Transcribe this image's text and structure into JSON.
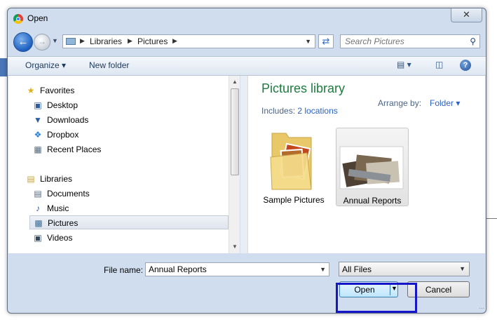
{
  "window": {
    "title": "Open",
    "close_glyph": "✕"
  },
  "address": {
    "segments": [
      "Libraries",
      "Pictures"
    ]
  },
  "search": {
    "placeholder": "Search Pictures"
  },
  "toolbar": {
    "organize": "Organize",
    "new_folder": "New folder"
  },
  "nav_pane": {
    "favorites_header": "Favorites",
    "favorites": [
      "Desktop",
      "Downloads",
      "Dropbox",
      "Recent Places"
    ],
    "libraries_header": "Libraries",
    "libraries": [
      "Documents",
      "Music",
      "Pictures",
      "Videos"
    ],
    "selected": "Pictures"
  },
  "content": {
    "title": "Pictures library",
    "includes_label": "Includes:",
    "includes_link": "2 locations",
    "arrange_label": "Arrange by:",
    "arrange_value": "Folder",
    "items": [
      "Sample Pictures",
      "Annual Reports"
    ],
    "selected_item": "Annual Reports"
  },
  "bottom": {
    "file_name_label": "File name:",
    "file_name_value": "Annual Reports",
    "filter_value": "All Files",
    "open_label": "Open",
    "cancel_label": "Cancel"
  },
  "colors": {
    "library_title": "#1e7a3f",
    "link": "#2b62c6",
    "highlight_box": "#1616c8",
    "back_button": "#1c5fc0"
  },
  "icons": {
    "back": "arrow-left-icon",
    "forward": "arrow-right-icon",
    "refresh": "refresh-icon",
    "search": "search-icon",
    "help": "help-icon",
    "favorites": "star-icon",
    "libraries": "library-icon"
  }
}
